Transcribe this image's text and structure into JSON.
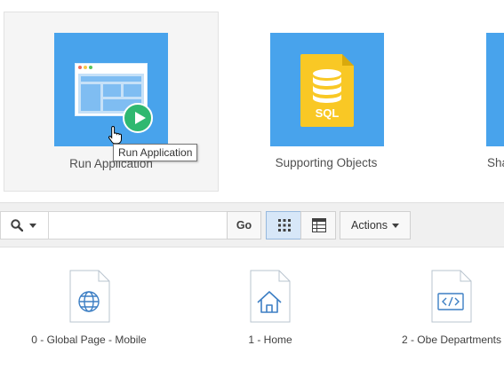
{
  "tiles": {
    "run": {
      "label": "Run Application"
    },
    "supporting": {
      "label": "Supporting Objects",
      "file_badge": "SQL"
    },
    "shared": {
      "label": "Sha"
    }
  },
  "tooltip": {
    "text": "Run Application"
  },
  "toolbar": {
    "search": {
      "value": "",
      "placeholder": ""
    },
    "go_label": "Go",
    "actions_label": "Actions",
    "view_mode": "icons"
  },
  "pages": [
    {
      "label": "0 - Global Page - Mobile",
      "icon": "globe-icon"
    },
    {
      "label": "1 - Home",
      "icon": "house-icon"
    },
    {
      "label": "2 - Obe Departments",
      "icon": "code-icon"
    }
  ],
  "colors": {
    "tile_blue": "#48a3ec",
    "play_green": "#2fb870",
    "sql_yellow": "#f9c825",
    "doc_icon_blue": "#3d7fc4",
    "toolbar_bg": "#f0f0f0",
    "selected_view_bg": "#d7e7f8"
  }
}
